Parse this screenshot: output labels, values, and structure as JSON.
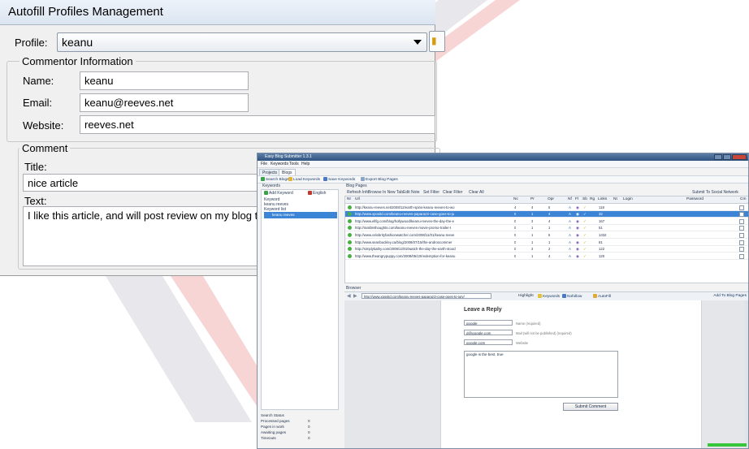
{
  "autofill": {
    "title": "Autofill Profiles Management",
    "profile_label": "Profile:",
    "profile_value": "keanu",
    "commentor_group": "Commentor Information",
    "name_label": "Name:",
    "name_value": "keanu",
    "email_label": "Email:",
    "email_value": "keanu@reeves.net",
    "website_label": "Website:",
    "website_value": "reeves.net",
    "comment_group": "Comment",
    "title_label": "Title:",
    "title_value": "nice article",
    "text_label": "Text:",
    "text_value": "I like this article, and will post review on my blog too."
  },
  "app": {
    "title": "Easy Blog Submitter 1.3.1",
    "menu": [
      "File",
      "Keywords",
      "Tools",
      "Help"
    ],
    "tabs": [
      "Projects",
      "Blogs"
    ],
    "toolbar": [
      "Search Blogs",
      "Load Keywords",
      "Save Keywords",
      "Export Blog Pages"
    ],
    "keywords_section": "Keywords",
    "add_keyword": "Add Keyword",
    "language": "English",
    "keyword_label": "Keyword",
    "keyword_item": "keanu reeves",
    "keyword_list_label": "Keyword list",
    "selected_keyword": "keanu reeves",
    "blog_pages_section": "Blog Pages",
    "grid_toolbar": [
      "Refresh Info",
      "Browse In New Tab",
      "Edit Note",
      "Set Filter",
      "Clear Filter",
      "Clear All"
    ],
    "submit_social": "Submit To Social Network",
    "columns": [
      "Nr",
      "Url",
      "Nc",
      "Pr",
      "Opr",
      "Nf",
      "Fl",
      "Sb",
      "Rg",
      "Links",
      "Nt",
      "Login",
      "Password",
      "Cm"
    ],
    "rows": [
      {
        "url": "http://keanu-reeves.net/2008/12/earth-spins-keanu-reeves-to-wo",
        "nc": "4",
        "pr": "4",
        "opr": "5",
        "links": "118",
        "selected": false
      },
      {
        "url": "http://www.xpositd.com/keanu-reeves-paparazzi-case-goes-to-ju",
        "nc": "0",
        "pr": "1",
        "opr": "4",
        "links": "32",
        "selected": true
      },
      {
        "url": "http://www.ellfg.com/blog/hollywood/keanu-reeves-the-day-the-e",
        "nc": "0",
        "pr": "3",
        "opr": "4",
        "links": "167",
        "selected": false
      },
      {
        "url": "http://ramblethoughts.com/keanu-reeves-movie-promo-trailer-t",
        "nc": "0",
        "pr": "1",
        "opr": "1",
        "links": "51",
        "selected": false
      },
      {
        "url": "http://www.celebrityfashionwatcher.com/2008/11/01/keanu-reeve",
        "nc": "0",
        "pr": "1",
        "opr": "5",
        "links": "1332",
        "selected": false
      },
      {
        "url": "http://www.seanbuckley.ca/blog/2008/07/15/the-androscommer",
        "nc": "0",
        "pr": "1",
        "opr": "1",
        "links": "81",
        "selected": false
      },
      {
        "url": "http://simplykathy.com/2008/12/02/watch-the-day-the-earth-stood",
        "nc": "0",
        "pr": "3",
        "opr": "2",
        "links": "122",
        "selected": false
      },
      {
        "url": "http://www.theangrypuppy.com/2008/05/10/redemption-for-keanu",
        "nc": "0",
        "pr": "1",
        "opr": "4",
        "links": "120",
        "selected": false
      }
    ],
    "browser_section": "Browser",
    "browser_url": "http://www.xpositd.com/keanu-reeves-paparazzi-case-goes-to-jury/",
    "highlight": "Highlight",
    "keywords_btn": "Keywords",
    "nofollow_btn": "Nofollow",
    "autofill_btn": "AutoFill",
    "add_to_blog_pages": "Add To Blog Pages",
    "page": {
      "heading": "Leave a Reply",
      "name_value": "google",
      "name_hint": "Name (required)",
      "mail_value": "d@google.com",
      "mail_hint": "Mail (will not be published) (required)",
      "website_value": "google.com",
      "website_hint": "Website",
      "comment_value": "google is the best. true",
      "submit": "Submit Comment"
    },
    "search_status": "Search Status",
    "processed_pages": "Processed pages",
    "processed_count": "0",
    "pages_in_work": "Pages in work",
    "in_work_count": "0",
    "awaiting_pages": "Awaiting pages",
    "awaiting_count": "0",
    "timeouts": "Timeouts",
    "timeouts_count": "0"
  }
}
